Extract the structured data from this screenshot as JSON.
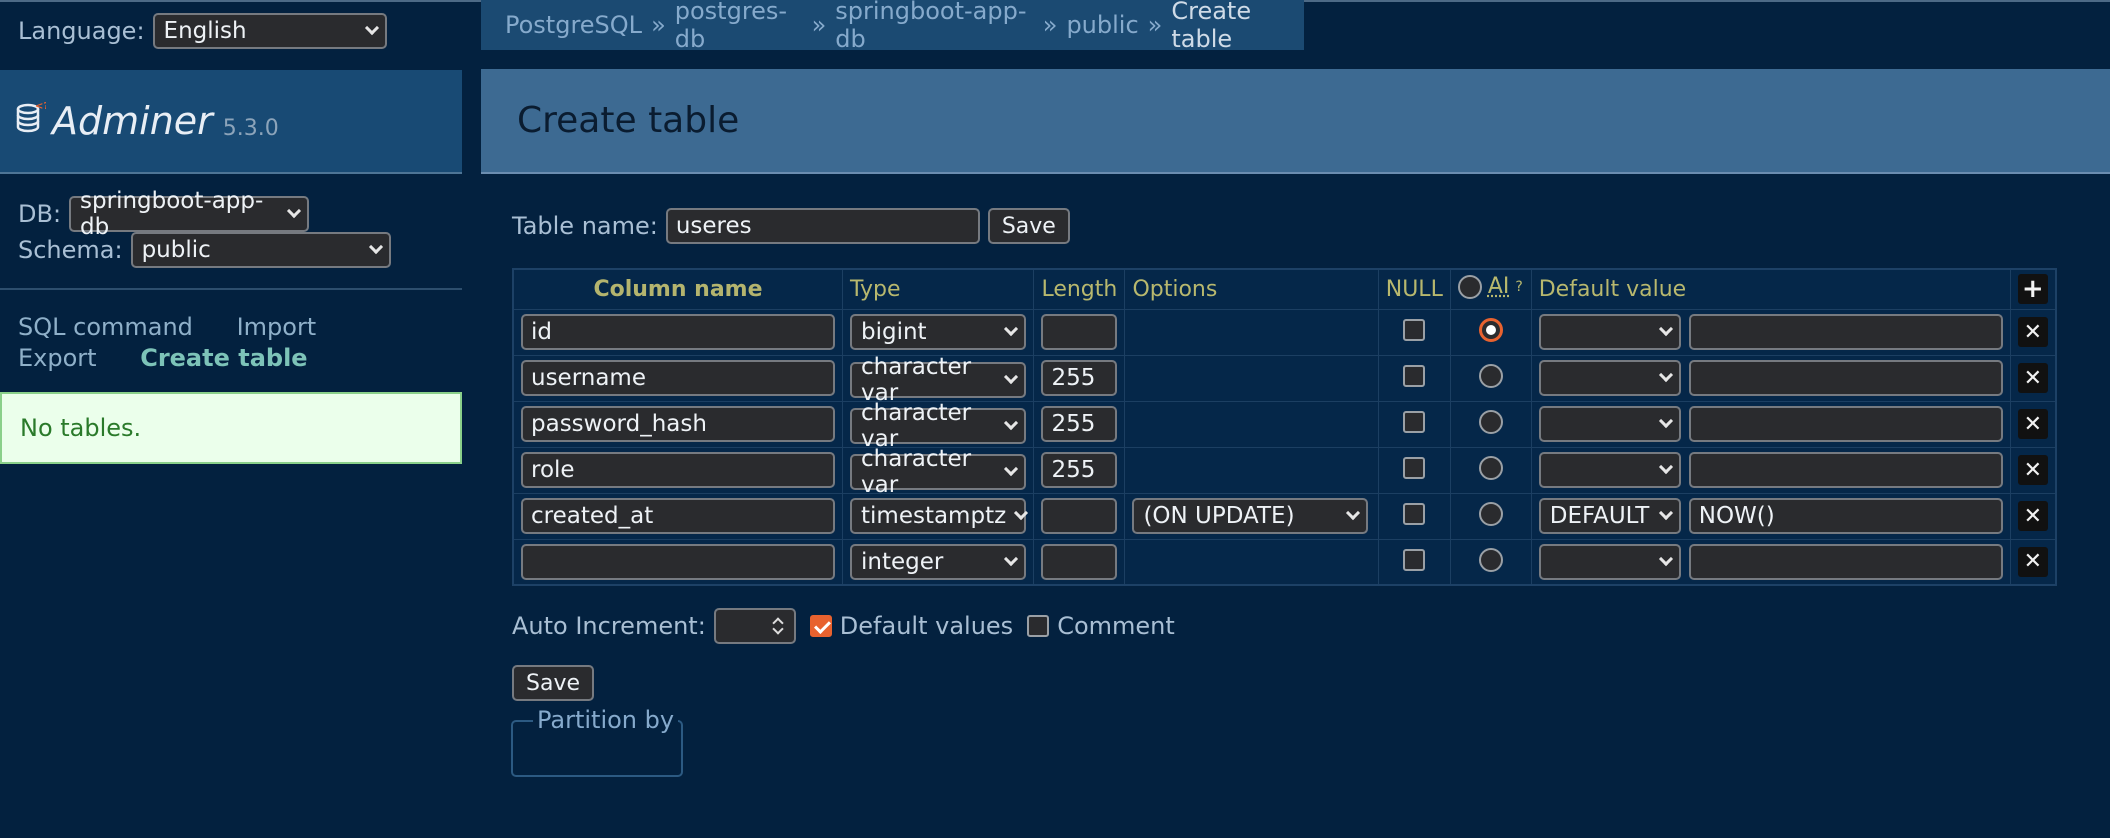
{
  "sidebar": {
    "language_label": "Language:",
    "language_value": "English",
    "brand_name": "Adminer",
    "brand_version": "5.3.0",
    "db_label": "DB:",
    "db_value": "springboot-app-db",
    "schema_label": "Schema:",
    "schema_value": "public",
    "links": {
      "sql_command": "SQL command",
      "import": "Import",
      "export": "Export",
      "create_table": "Create table"
    },
    "no_tables": "No tables."
  },
  "breadcrumb": {
    "items": [
      "PostgreSQL",
      "postgres-db",
      "springboot-app-db",
      "public"
    ],
    "separator": "»",
    "current": "Create table"
  },
  "page_title": "Create table",
  "form": {
    "table_name_label": "Table name:",
    "table_name_value": "useres",
    "save_label": "Save",
    "headers": {
      "column_name": "Column name",
      "type": "Type",
      "length": "Length",
      "options": "Options",
      "null": "NULL",
      "ai": "AI",
      "ai_help": "?",
      "default_value": "Default value"
    },
    "rows": [
      {
        "name": "id",
        "type": "bigint",
        "length": "",
        "options": "",
        "null": false,
        "ai": true,
        "default_type": "",
        "default_value": ""
      },
      {
        "name": "username",
        "type": "character var",
        "length": "255",
        "options": "",
        "null": false,
        "ai": false,
        "default_type": "",
        "default_value": ""
      },
      {
        "name": "password_hash",
        "type": "character var",
        "length": "255",
        "options": "",
        "null": false,
        "ai": false,
        "default_type": "",
        "default_value": ""
      },
      {
        "name": "role",
        "type": "character var",
        "length": "255",
        "options": "",
        "null": false,
        "ai": false,
        "default_type": "",
        "default_value": ""
      },
      {
        "name": "created_at",
        "type": "timestamptz",
        "length": "",
        "options": "(ON UPDATE)",
        "null": false,
        "ai": false,
        "default_type": "DEFAULT",
        "default_value": "NOW()"
      },
      {
        "name": "",
        "type": "integer",
        "length": "",
        "options": "",
        "null": false,
        "ai": false,
        "default_type": "",
        "default_value": ""
      }
    ],
    "auto_increment_label": "Auto Increment:",
    "default_values_label": "Default values",
    "default_values_checked": true,
    "comment_label": "Comment",
    "comment_checked": false,
    "partition_label": "Partition by"
  },
  "colors": {
    "background": "#03213f",
    "accent": "#e8622f",
    "header_text": "#b8b86e",
    "link": "#86aacc"
  },
  "icons": {
    "add": "plus-icon",
    "remove": "close-icon",
    "logo": "database-icon"
  }
}
